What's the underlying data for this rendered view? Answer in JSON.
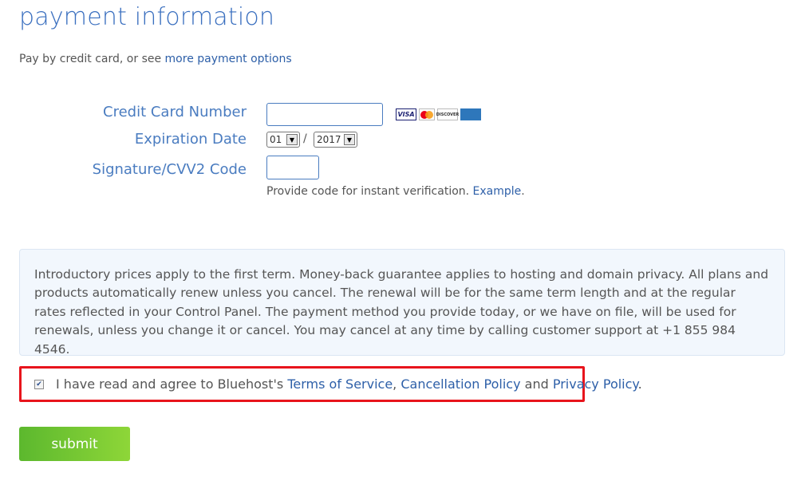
{
  "page": {
    "title": "payment information",
    "intro_text": "Pay by credit card, or see ",
    "intro_link": "more payment options"
  },
  "form": {
    "cc_label": "Credit Card Number",
    "exp_label": "Expiration Date",
    "cvv_label": "Signature/CVV2 Code",
    "cc_value": "",
    "cvv_value": "",
    "exp_month": "01",
    "exp_separator": "/",
    "exp_year": "2017",
    "hint_text": "Provide code for instant verification. ",
    "hint_link": "Example",
    "hint_end": "."
  },
  "cards": {
    "visa": "VISA",
    "discover": "DISCOVER",
    "amex": "AMERICAN EXPRESS"
  },
  "notice": {
    "text": "Introductory prices apply to the first term. Money-back guarantee applies to hosting and domain privacy. All plans and products automatically renew unless you cancel. The renewal will be for the same term length and at the regular rates reflected in your Control Panel. The payment method you provide today, or we have on file, will be used for renewals, unless you change it or cancel. You may cancel at any time by calling customer support at +1 855 984 4546."
  },
  "terms": {
    "checked": true,
    "prefix": "I have read and agree to Bluehost's ",
    "tos": "Terms of Service",
    "sep1": ", ",
    "cancellation": "Cancellation Policy",
    "and": " and ",
    "privacy": "Privacy Policy",
    "end": "."
  },
  "actions": {
    "submit_label": "submit"
  },
  "colors": {
    "accent": "#3a6fbf",
    "link": "#2d5fa8",
    "highlight_border": "#e8141c",
    "submit_green": "#7cc634"
  }
}
